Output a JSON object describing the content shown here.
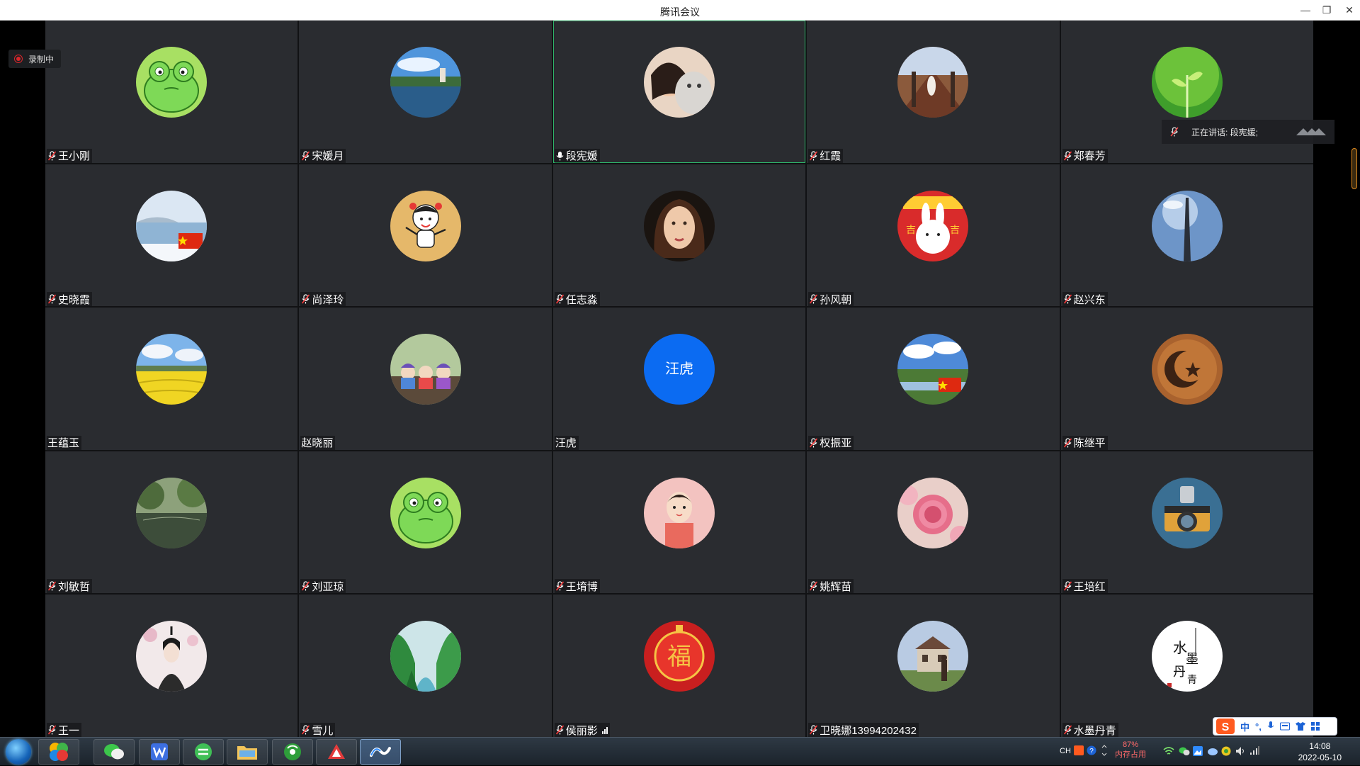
{
  "window": {
    "title": "腾讯会议",
    "minimize_glyph": "—",
    "restore_glyph": "❐",
    "close_glyph": "✕"
  },
  "recording": {
    "label": "录制中"
  },
  "speaking": {
    "label": "正在讲话: 段宪媛;"
  },
  "participants": [
    {
      "name": "王小刚",
      "avatar": "frog-icon",
      "mic": true
    },
    {
      "name": "宋媛月",
      "avatar": "lake-photo",
      "mic": true
    },
    {
      "name": "段宪媛",
      "avatar": "girl-cat-photo",
      "mic": true,
      "mic_on": true,
      "active": true
    },
    {
      "name": "红霞",
      "avatar": "bridge-photo",
      "mic": true
    },
    {
      "name": "郑春芳",
      "avatar": "sprout-photo",
      "mic": true
    },
    {
      "name": "史晓霞",
      "avatar": "winter-lake-photo",
      "mic": true
    },
    {
      "name": "尚泽玲",
      "avatar": "cartoon-girl-icon",
      "mic": true
    },
    {
      "name": "任志淼",
      "avatar": "woman-portrait-photo",
      "mic": true
    },
    {
      "name": "孙风朝",
      "avatar": "rabbit-icon",
      "mic": true
    },
    {
      "name": "赵兴东",
      "avatar": "sky-tower-photo",
      "mic": true
    },
    {
      "name": "王蕴玉",
      "avatar": "rapeseed-field-photo",
      "mic": false
    },
    {
      "name": "赵晓丽",
      "avatar": "dolls-photo",
      "mic": false
    },
    {
      "name": "汪虎",
      "avatar": "text",
      "avatar_text": "汪虎",
      "mic": false
    },
    {
      "name": "权振亚",
      "avatar": "wetland-photo",
      "mic": true
    },
    {
      "name": "陈继平",
      "avatar": "crescent-icon",
      "mic": true
    },
    {
      "name": "刘敏哲",
      "avatar": "pond-photo",
      "mic": true
    },
    {
      "name": "刘亚琼",
      "avatar": "frog-icon",
      "mic": true
    },
    {
      "name": "王堉博",
      "avatar": "child-drawing-icon",
      "mic": true
    },
    {
      "name": "姚辉苗",
      "avatar": "peony-photo",
      "mic": true
    },
    {
      "name": "王培红",
      "avatar": "camera-photo",
      "mic": true
    },
    {
      "name": "王一",
      "avatar": "ink-figure-icon",
      "mic": true
    },
    {
      "name": "雪儿",
      "avatar": "valley-photo",
      "mic": true
    },
    {
      "name": "侯丽影",
      "avatar": "fu-lantern-icon",
      "mic": true,
      "signal": true
    },
    {
      "name": "卫晓娜13994202432",
      "avatar": "house-photo",
      "mic": true
    },
    {
      "name": "水墨丹青",
      "avatar": "calligraphy-icon",
      "mic": true
    }
  ],
  "ime": {
    "logo": "S",
    "mode": "中"
  },
  "tray": {
    "lang": "CH",
    "memory_percent": "87%",
    "memory_label": "内存占用",
    "time": "14:08",
    "date": "2022-05-10"
  }
}
